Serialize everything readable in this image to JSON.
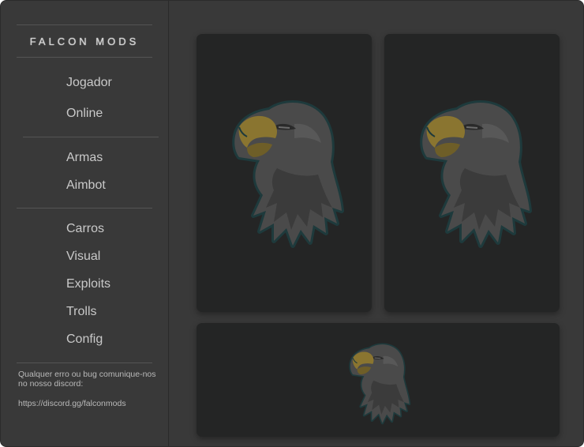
{
  "sidebar": {
    "brand": "FALCON MODS",
    "groups": [
      {
        "items": [
          {
            "label": "Jogador"
          },
          {
            "label": "Online"
          }
        ]
      },
      {
        "items": [
          {
            "label": "Armas"
          },
          {
            "label": "Aimbot"
          }
        ]
      },
      {
        "items": [
          {
            "label": "Carros"
          },
          {
            "label": "Visual"
          },
          {
            "label": "Exploits"
          },
          {
            "label": "Trolls"
          },
          {
            "label": "Config"
          }
        ]
      }
    ],
    "footer": {
      "message": "Qualquer erro ou bug comunique-nos no nosso discord:",
      "link": "https://discord.gg/falconmods"
    }
  },
  "main": {
    "cards": [
      {
        "image": "eagle-logo-icon"
      },
      {
        "image": "eagle-logo-icon"
      },
      {
        "image": "eagle-logo-icon"
      }
    ]
  },
  "colors": {
    "window_bg": "#383838",
    "card_bg": "#242525",
    "text": "#c9c9c9",
    "eagle_outline": "#1e3a3c",
    "eagle_beak": "#8a7530"
  }
}
